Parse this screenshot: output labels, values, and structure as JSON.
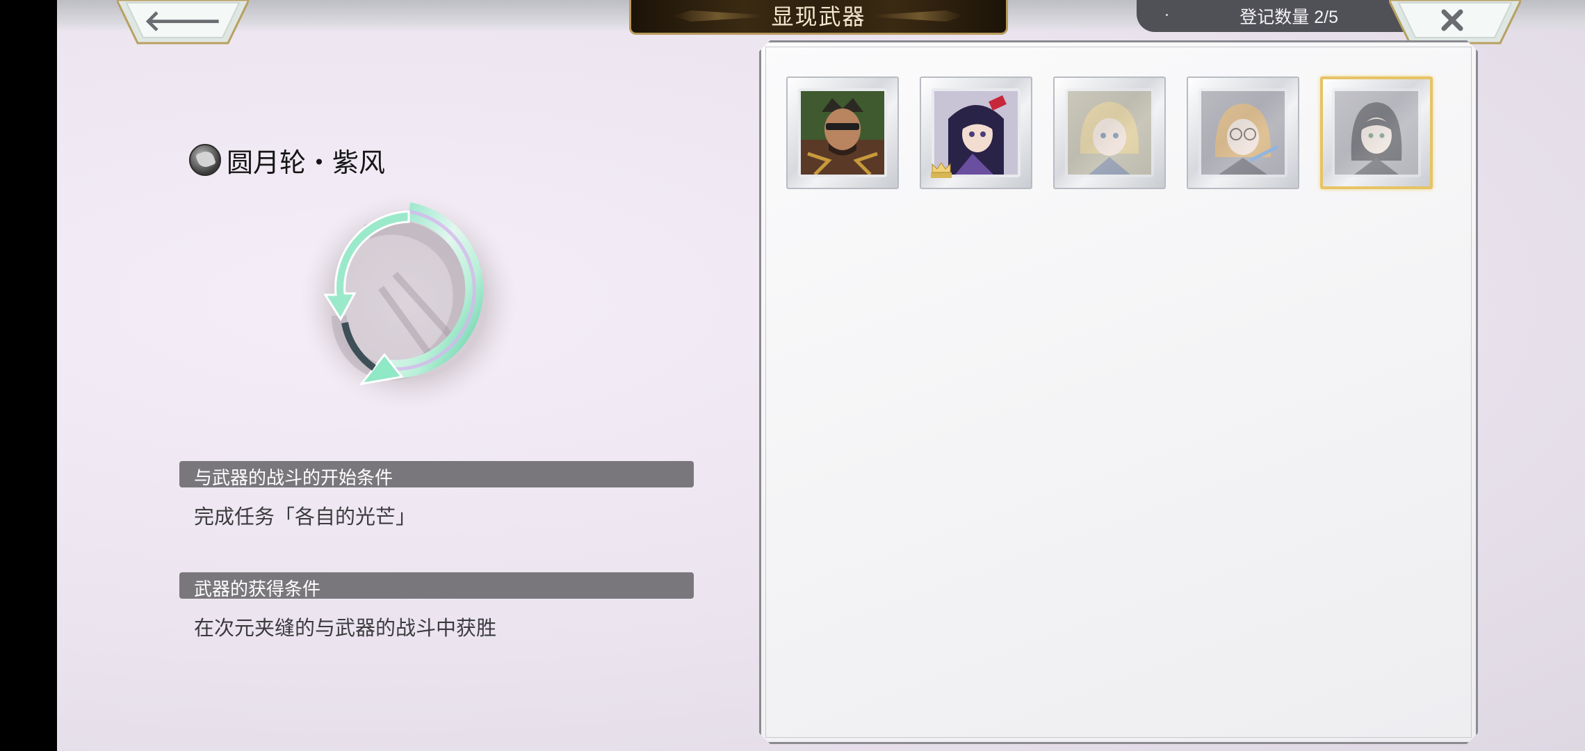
{
  "header": {
    "title": "显现武器",
    "count_label": "登记数量 2/5"
  },
  "weapon": {
    "name": "圆月轮・紫风",
    "start_condition_title": "与武器的战斗的开始条件",
    "start_condition": "完成任务「各自的光芒」",
    "obtain_condition_title": "武器的获得条件",
    "obtain_condition": "在次元夹缝的与武器的战斗中获胜"
  },
  "characters": [
    {
      "icon": "character-portrait-warrior",
      "registered": true,
      "selected": false,
      "crown": false
    },
    {
      "icon": "character-portrait-swordswoman",
      "registered": true,
      "selected": false,
      "crown": true
    },
    {
      "icon": "character-portrait-blonde-girl",
      "registered": false,
      "selected": false,
      "crown": false
    },
    {
      "icon": "character-portrait-glasses-girl",
      "registered": false,
      "selected": false,
      "crown": false
    },
    {
      "icon": "character-portrait-dark-hair-girl",
      "registered": false,
      "selected": true,
      "crown": false
    }
  ],
  "colors": {
    "accent_gold": "#e6c364",
    "header_bg": "#7a777c",
    "title_text": "#f3e8cf"
  }
}
